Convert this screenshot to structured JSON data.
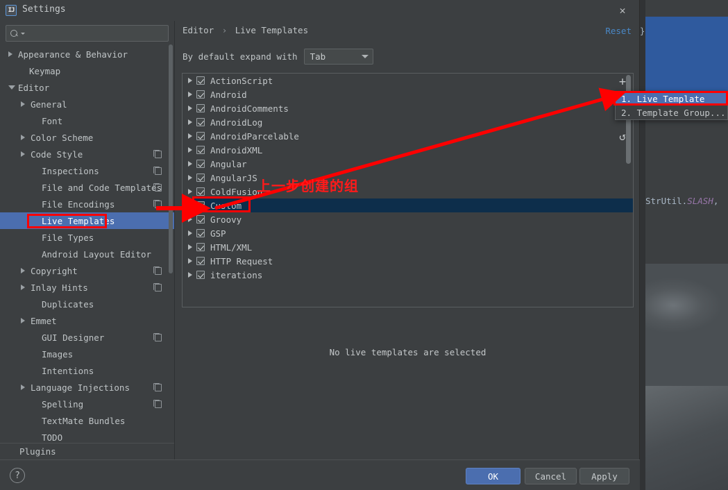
{
  "window": {
    "title": "Settings",
    "app_icon": "intellij-idea-icon",
    "close_icon": "close-icon"
  },
  "sidebar": {
    "search": {
      "value": "",
      "placeholder": "",
      "icon": "search-icon"
    },
    "items": [
      {
        "label": "Appearance & Behavior",
        "indent": 10,
        "arrow": "right",
        "copy": false,
        "selected": false
      },
      {
        "label": "Keymap",
        "indent": 26,
        "arrow": "none",
        "copy": false,
        "selected": false
      },
      {
        "label": "Editor",
        "indent": 10,
        "arrow": "down",
        "copy": false,
        "selected": false
      },
      {
        "label": "General",
        "indent": 28,
        "arrow": "right",
        "copy": false,
        "selected": false
      },
      {
        "label": "Font",
        "indent": 44,
        "arrow": "none",
        "copy": false,
        "selected": false
      },
      {
        "label": "Color Scheme",
        "indent": 28,
        "arrow": "right",
        "copy": false,
        "selected": false
      },
      {
        "label": "Code Style",
        "indent": 28,
        "arrow": "right",
        "copy": true,
        "selected": false
      },
      {
        "label": "Inspections",
        "indent": 44,
        "arrow": "none",
        "copy": true,
        "selected": false
      },
      {
        "label": "File and Code Templates",
        "indent": 44,
        "arrow": "none",
        "copy": true,
        "selected": false
      },
      {
        "label": "File Encodings",
        "indent": 44,
        "arrow": "none",
        "copy": true,
        "selected": false
      },
      {
        "label": "Live Templates",
        "indent": 44,
        "arrow": "none",
        "copy": false,
        "selected": true
      },
      {
        "label": "File Types",
        "indent": 44,
        "arrow": "none",
        "copy": false,
        "selected": false
      },
      {
        "label": "Android Layout Editor",
        "indent": 44,
        "arrow": "none",
        "copy": false,
        "selected": false
      },
      {
        "label": "Copyright",
        "indent": 28,
        "arrow": "right",
        "copy": true,
        "selected": false
      },
      {
        "label": "Inlay Hints",
        "indent": 28,
        "arrow": "right",
        "copy": true,
        "selected": false
      },
      {
        "label": "Duplicates",
        "indent": 44,
        "arrow": "none",
        "copy": false,
        "selected": false
      },
      {
        "label": "Emmet",
        "indent": 28,
        "arrow": "right",
        "copy": false,
        "selected": false
      },
      {
        "label": "GUI Designer",
        "indent": 44,
        "arrow": "none",
        "copy": true,
        "selected": false
      },
      {
        "label": "Images",
        "indent": 44,
        "arrow": "none",
        "copy": false,
        "selected": false
      },
      {
        "label": "Intentions",
        "indent": 44,
        "arrow": "none",
        "copy": false,
        "selected": false
      },
      {
        "label": "Language Injections",
        "indent": 28,
        "arrow": "right",
        "copy": true,
        "selected": false
      },
      {
        "label": "Spelling",
        "indent": 44,
        "arrow": "none",
        "copy": true,
        "selected": false
      },
      {
        "label": "TextMate Bundles",
        "indent": 44,
        "arrow": "none",
        "copy": false,
        "selected": false
      },
      {
        "label": "TODO",
        "indent": 44,
        "arrow": "none",
        "copy": false,
        "selected": false
      }
    ],
    "plugins_label": "Plugins"
  },
  "content": {
    "breadcrumb_root": "Editor",
    "breadcrumb_sep": "›",
    "breadcrumb_leaf": "Live Templates",
    "reset_label": "Reset",
    "expand_label": "By default expand with",
    "expand_value": "Tab",
    "empty_message": "No live templates are selected",
    "template_groups": [
      {
        "label": "ActionScript",
        "checked": true,
        "expandable": true,
        "selected": false
      },
      {
        "label": "Android",
        "checked": true,
        "expandable": true,
        "selected": false
      },
      {
        "label": "AndroidComments",
        "checked": true,
        "expandable": true,
        "selected": false
      },
      {
        "label": "AndroidLog",
        "checked": true,
        "expandable": true,
        "selected": false
      },
      {
        "label": "AndroidParcelable",
        "checked": true,
        "expandable": true,
        "selected": false
      },
      {
        "label": "AndroidXML",
        "checked": true,
        "expandable": true,
        "selected": false
      },
      {
        "label": "Angular",
        "checked": true,
        "expandable": true,
        "selected": false
      },
      {
        "label": "AngularJS",
        "checked": true,
        "expandable": true,
        "selected": false
      },
      {
        "label": "ColdFusion",
        "checked": true,
        "expandable": true,
        "selected": false
      },
      {
        "label": "Custom",
        "checked": true,
        "expandable": false,
        "selected": true
      },
      {
        "label": "Groovy",
        "checked": true,
        "expandable": true,
        "selected": false
      },
      {
        "label": "GSP",
        "checked": true,
        "expandable": true,
        "selected": false
      },
      {
        "label": "HTML/XML",
        "checked": true,
        "expandable": true,
        "selected": false
      },
      {
        "label": "HTTP Request",
        "checked": true,
        "expandable": true,
        "selected": false
      },
      {
        "label": "iterations",
        "checked": true,
        "expandable": true,
        "selected": false
      }
    ]
  },
  "toolbar": {
    "add_icon": "plus-icon",
    "add_label": "+",
    "undo_icon": "undo-icon",
    "undo_label": "↺"
  },
  "popup": {
    "items": [
      {
        "label": "1. Live Template",
        "selected": true
      },
      {
        "label": "2. Template Group...",
        "selected": false
      }
    ]
  },
  "footer": {
    "help_label": "?",
    "ok_label": "OK",
    "cancel_label": "Cancel",
    "apply_label": "Apply"
  },
  "annotations": {
    "chinese_note": "上一步创建的组",
    "color": "#ff0000"
  },
  "background": {
    "code_text": "StrUtil.",
    "code_const": "SLASH",
    "code_tail": ",",
    "brace": "}"
  }
}
